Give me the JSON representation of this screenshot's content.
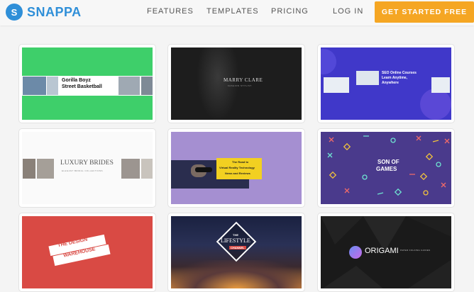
{
  "brand": {
    "logo_letter": "S",
    "name": "SNAPPA",
    "color": "#2f8fd8"
  },
  "nav": {
    "features": "FEATURES",
    "templates": "TEMPLATES",
    "pricing": "PRICING",
    "login": "LOG IN",
    "cta": "GET STARTED FREE",
    "cta_color": "#f5a623"
  },
  "templates": [
    {
      "title_line1": "Gorilla Boyz",
      "title_line2": "Street Basketball",
      "bg": "#3ecf6a"
    },
    {
      "title": "MARRY CLARE",
      "subtitle": "FASHION STYLIST"
    },
    {
      "line1": "SEO Online Courses",
      "line2": "Learn Anytime,",
      "line3": "Anywhere",
      "bg": "#4038c9"
    },
    {
      "title": "LUXURY BRIDES",
      "subtitle": "ELEGANT BRIDAL COLLECTIONS"
    },
    {
      "line1": "The Road to",
      "line2": "Virtual Reality Technology",
      "line3": "News and Reviews",
      "bg": "#a58fd1"
    },
    {
      "line1": "SON OF",
      "line2": "GAMES",
      "bg": "#4a3a8c"
    },
    {
      "line1": "THE DESIGN",
      "line2": "WAREHOUSE",
      "bg": "#d94a44"
    },
    {
      "line1": "THE",
      "line2": "LIFESTYLE",
      "line3": "CHANNEL"
    },
    {
      "title": "ORIGAMI",
      "tagline": "PAPER FOLDING GUIDES"
    }
  ]
}
